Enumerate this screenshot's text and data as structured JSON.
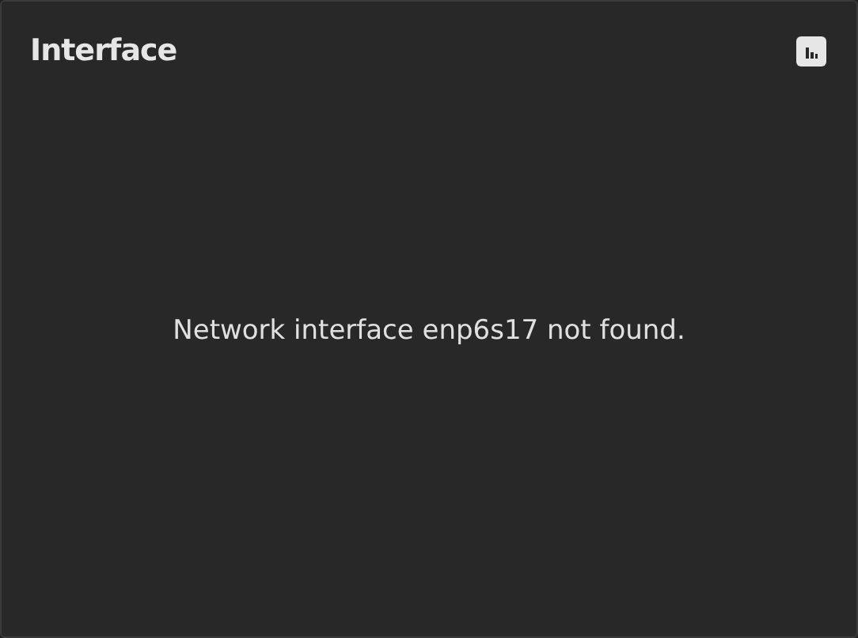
{
  "title": "Interface",
  "message": "Network interface enp6s17 not found."
}
